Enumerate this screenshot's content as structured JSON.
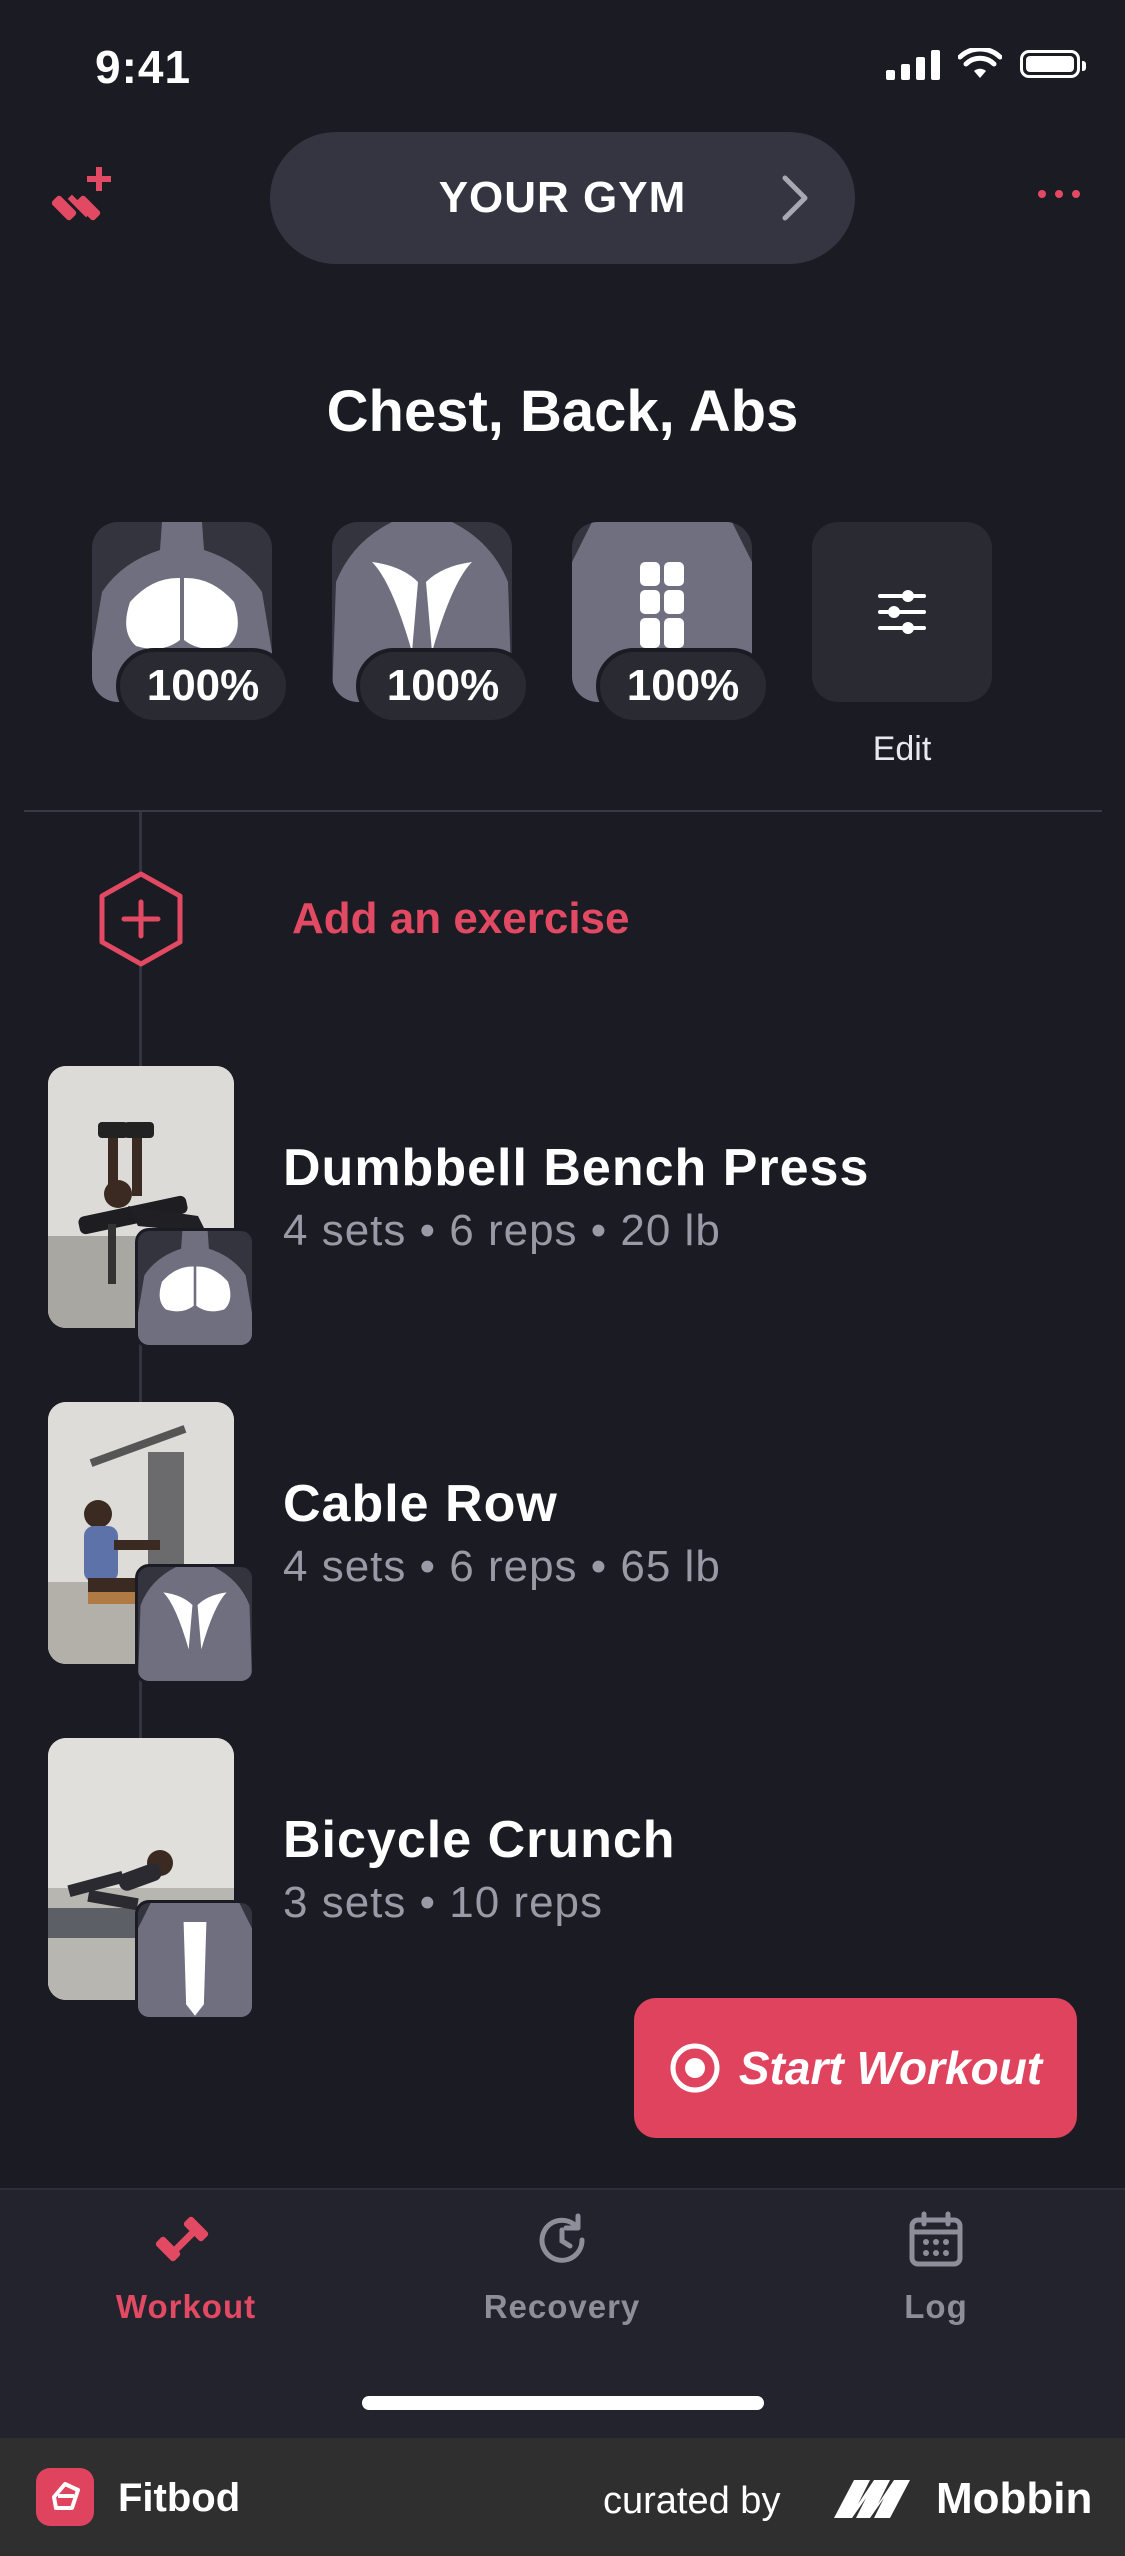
{
  "status_bar": {
    "time": "9:41"
  },
  "header": {
    "gym_label": "YOUR GYM"
  },
  "muscle_groups": {
    "title": "Chest, Back, Abs",
    "items": [
      {
        "name": "chest",
        "recovery": "100%"
      },
      {
        "name": "back",
        "recovery": "100%"
      },
      {
        "name": "abs",
        "recovery": "100%"
      }
    ],
    "edit_label": "Edit"
  },
  "add_exercise": {
    "label": "Add an exercise"
  },
  "exercises": [
    {
      "name": "Dumbbell Bench Press",
      "detail": "4 sets • 6 reps • 20 lb"
    },
    {
      "name": "Cable Row",
      "detail": "4 sets • 6 reps • 65 lb"
    },
    {
      "name": "Bicycle Crunch",
      "detail": "3 sets • 10 reps"
    }
  ],
  "start_button": {
    "label": "Start Workout"
  },
  "tabs": [
    {
      "label": "Workout",
      "active": true,
      "icon": "dumbbell-icon"
    },
    {
      "label": "Recovery",
      "active": false,
      "icon": "recovery-clock-icon"
    },
    {
      "label": "Log",
      "active": false,
      "icon": "calendar-icon"
    }
  ],
  "footer": {
    "app_name": "Fitbod",
    "curated_by": "curated by",
    "brand": "Mobbin"
  },
  "colors": {
    "background": "#1b1b23",
    "accent": "#e0435d",
    "tile": "#34343f"
  }
}
